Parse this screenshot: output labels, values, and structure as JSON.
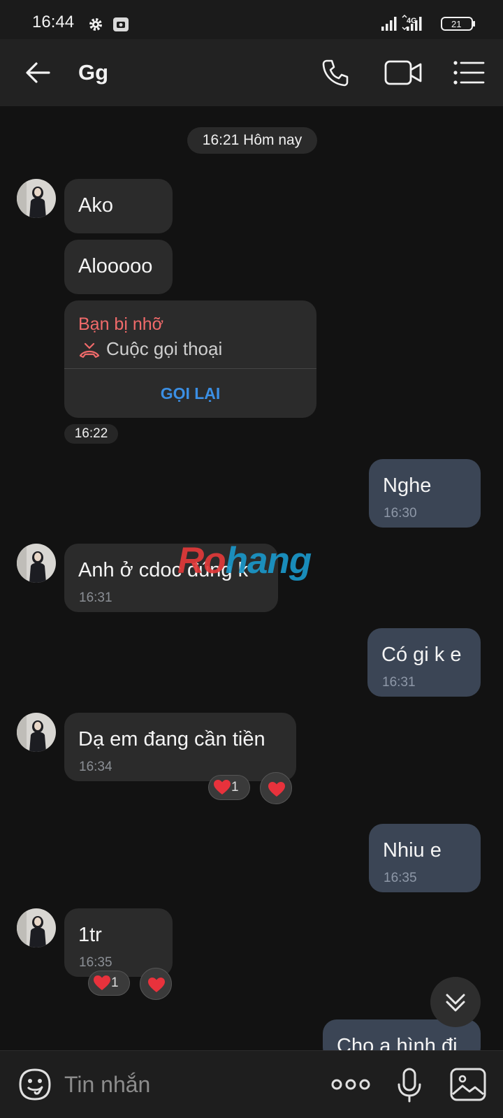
{
  "status_bar": {
    "time": "16:44",
    "network": "4G",
    "battery": "21",
    "icons": [
      "gear-icon",
      "screenshot-icon",
      "signal-icon",
      "signal-4g-icon",
      "battery-icon"
    ]
  },
  "header": {
    "title": "Gg",
    "icons": [
      "back-arrow-icon",
      "phone-icon",
      "video-camera-icon",
      "list-menu-icon"
    ]
  },
  "date_chip": "16:21 Hôm nay",
  "messages": [
    {
      "direction": "in",
      "text": "Ako",
      "time": ""
    },
    {
      "direction": "in",
      "text": "Alooooo",
      "time": ""
    },
    {
      "direction": "in",
      "type": "missed_call"
    },
    {
      "direction": "out",
      "text": "Nghe",
      "time": "16:30"
    },
    {
      "direction": "in",
      "text": "Anh ở cdoc đúng k",
      "time": "16:31"
    },
    {
      "direction": "out",
      "text": "Có gi k e",
      "time": "16:31"
    },
    {
      "direction": "in",
      "text": "Dạ em đang cần tiền",
      "time": "16:34",
      "reaction": "heart",
      "reaction_count": "1"
    },
    {
      "direction": "out",
      "text": "Nhiu e",
      "time": "16:35"
    },
    {
      "direction": "in",
      "text": "1tr",
      "time": "16:35",
      "reaction": "heart",
      "reaction_count": "1"
    },
    {
      "direction": "out",
      "text": "Cho a hình đi",
      "time": ""
    }
  ],
  "missed_call": {
    "title": "Bạn bị nhỡ",
    "subtitle": "Cuộc gọi thoại",
    "action": "GỌI LẠI",
    "time": "16:22"
  },
  "watermark": {
    "part_a": "Ro",
    "part_b": "hang"
  },
  "composer": {
    "placeholder": "Tin nhắn",
    "icons": [
      "emoji-icon",
      "more-dots-icon",
      "microphone-icon",
      "image-gallery-icon"
    ]
  },
  "colors": {
    "background": "#121212",
    "incoming_bubble": "#2b2b2b",
    "outgoing_bubble": "#3b4555",
    "missed_call_red": "#f06a6a",
    "link_blue": "#3b8fe4",
    "heart_red": "#e8323c"
  }
}
